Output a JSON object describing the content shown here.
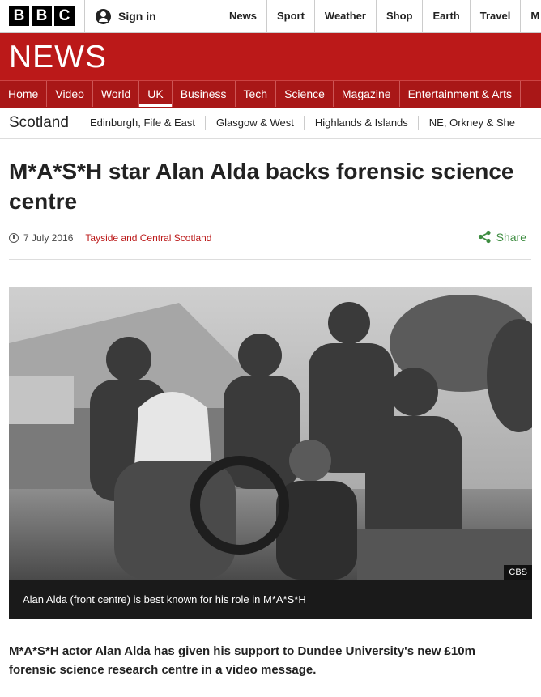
{
  "brand": {
    "letters": [
      "B",
      "B",
      "C"
    ],
    "section_name": "NEWS"
  },
  "account": {
    "signin_label": "Sign in"
  },
  "top_nav": [
    "News",
    "Sport",
    "Weather",
    "Shop",
    "Earth",
    "Travel",
    "M"
  ],
  "section_nav": {
    "items": [
      "Home",
      "Video",
      "World",
      "UK",
      "Business",
      "Tech",
      "Science",
      "Magazine",
      "Entertainment & Arts"
    ],
    "active": "UK"
  },
  "region_nav": {
    "region": "Scotland",
    "items": [
      "Edinburgh, Fife & East",
      "Glasgow & West",
      "Highlands & Islands",
      "NE, Orkney & She"
    ]
  },
  "article": {
    "headline": "M*A*S*H star Alan Alda backs forensic science centre",
    "date": "7 July 2016",
    "location": "Tayside and Central Scotland",
    "share_label": "Share",
    "image_credit": "CBS",
    "image_caption": "Alan Alda (front centre) is best known for his role in M*A*S*H",
    "intro": "M*A*S*H actor Alan Alda has given his support to Dundee University's new £10m forensic science research centre in a video message."
  },
  "colors": {
    "bbc_red": "#bb1919",
    "nav_red": "#a91717",
    "share_green": "#3d8c40"
  },
  "icons": [
    "user-icon",
    "clock-icon",
    "share-icon"
  ]
}
